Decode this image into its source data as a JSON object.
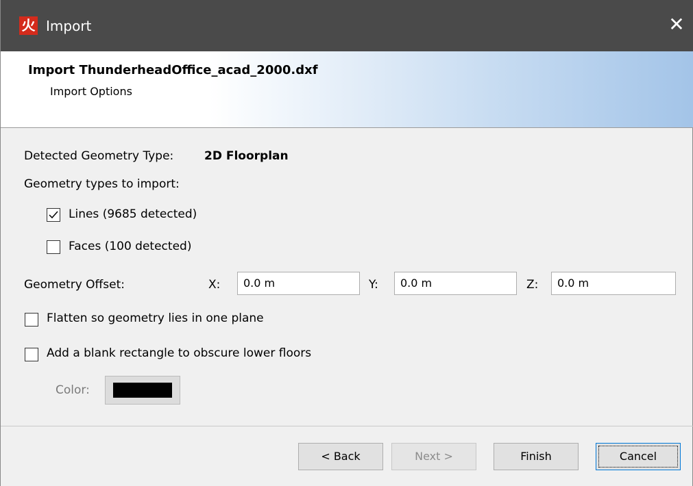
{
  "window": {
    "title": "Import",
    "app_icon": "pyrosim-flame-icon",
    "close_glyph": "✕"
  },
  "header": {
    "title": "Import ThunderheadOffice_acad_2000.dxf",
    "subtitle": "Import Options"
  },
  "geometry": {
    "detected_label": "Detected Geometry Type:",
    "detected_value": "2D Floorplan",
    "types_label": "Geometry types to import:",
    "lines": {
      "label": "Lines (9685 detected)",
      "checked": true
    },
    "faces": {
      "label": "Faces (100 detected)",
      "checked": false
    }
  },
  "offset": {
    "label": "Geometry Offset:",
    "x_label": "X:",
    "x_value": "0.0 m",
    "y_label": "Y:",
    "y_value": "0.0 m",
    "z_label": "Z:",
    "z_value": "0.0 m"
  },
  "options": {
    "flatten": {
      "label": "Flatten so geometry lies in one plane",
      "checked": false
    },
    "blank_rect": {
      "label": "Add a blank rectangle to obscure lower floors",
      "checked": false
    },
    "color_label": "Color:",
    "color_value": "#000000"
  },
  "buttons": {
    "back": "< Back",
    "next": "Next >",
    "finish": "Finish",
    "cancel": "Cancel"
  }
}
